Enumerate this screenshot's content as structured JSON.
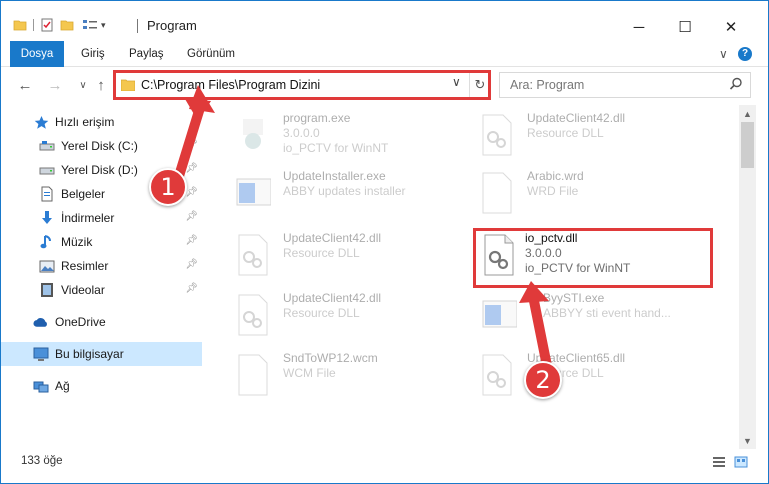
{
  "window": {
    "title": "Program",
    "controls": {
      "minimize": "─",
      "maximize": "☐",
      "close": "✕"
    }
  },
  "ribbon": {
    "tabs": [
      "Dosya",
      "Giriş",
      "Paylaş",
      "Görünüm"
    ],
    "expand_icon": "∨",
    "help_icon": "?"
  },
  "address_bar": {
    "path": "C:\\Program Files\\Program Dizini",
    "search_placeholder": "Ara: Program"
  },
  "sidebar": {
    "items": [
      {
        "label": "Hızlı erişim",
        "icon": "star-icon",
        "pinned": false
      },
      {
        "label": "Yerel Disk (C:)",
        "icon": "drive-icon",
        "pinned": true
      },
      {
        "label": "Yerel Disk (D:)",
        "icon": "drive-icon",
        "pinned": true
      },
      {
        "label": "Belgeler",
        "icon": "documents-icon",
        "pinned": true
      },
      {
        "label": "İndirmeler",
        "icon": "download-icon",
        "pinned": true
      },
      {
        "label": "Müzik",
        "icon": "music-icon",
        "pinned": true
      },
      {
        "label": "Resimler",
        "icon": "pictures-icon",
        "pinned": true
      },
      {
        "label": "Videolar",
        "icon": "videos-icon",
        "pinned": true
      },
      {
        "label": "OneDrive",
        "icon": "cloud-icon",
        "pinned": false
      },
      {
        "label": "Bu bilgisayar",
        "icon": "computer-icon",
        "pinned": false,
        "selected": true
      },
      {
        "label": "Ağ",
        "icon": "network-icon",
        "pinned": false
      }
    ]
  },
  "files": [
    {
      "name": "program.exe",
      "line2": "3.0.0.0",
      "line3": "io_PCTV for WinNT",
      "icon": "exe-icon",
      "faded": true
    },
    {
      "name": "UpdateClient42.dll",
      "line2": "Resource DLL",
      "line3": "",
      "icon": "dll-icon",
      "faded": true
    },
    {
      "name": "UpdateInstaller.exe",
      "line2": "ABBY updates installer",
      "line3": "",
      "icon": "installer-icon",
      "faded": true
    },
    {
      "name": "Arabic.wrd",
      "line2": "WRD File",
      "line3": "",
      "icon": "blank-file-icon",
      "faded": true
    },
    {
      "name": "UpdateClient42.dll",
      "line2": "Resource DLL",
      "line3": "",
      "icon": "dll-icon",
      "faded": true
    },
    {
      "name": "io_pctv.dll",
      "line2": "3.0.0.0",
      "line3": "io_PCTV for WinNT",
      "icon": "dll-icon",
      "faded": false
    },
    {
      "name": "UpdateClient42.dll",
      "line2": "Resource DLL",
      "line3": "",
      "icon": "dll-icon",
      "faded": true
    },
    {
      "name": "ByySTI.exe",
      "line2": "ABBYY sti event hand...",
      "line3": "",
      "icon": "installer-icon",
      "faded": true
    },
    {
      "name": "SndToWP12.wcm",
      "line2": "WCM File",
      "line3": "",
      "icon": "blank-file-icon",
      "faded": true
    },
    {
      "name": "UpdateClient65.dll",
      "line2": "Resource DLL",
      "line3": "",
      "icon": "dll-icon",
      "faded": true
    }
  ],
  "status": {
    "item_count": "133 öğe"
  },
  "callouts": [
    "1",
    "2"
  ],
  "colors": {
    "accent": "#1979ca",
    "highlight_box": "#e03a3a",
    "selected_bg": "#cce8ff"
  }
}
